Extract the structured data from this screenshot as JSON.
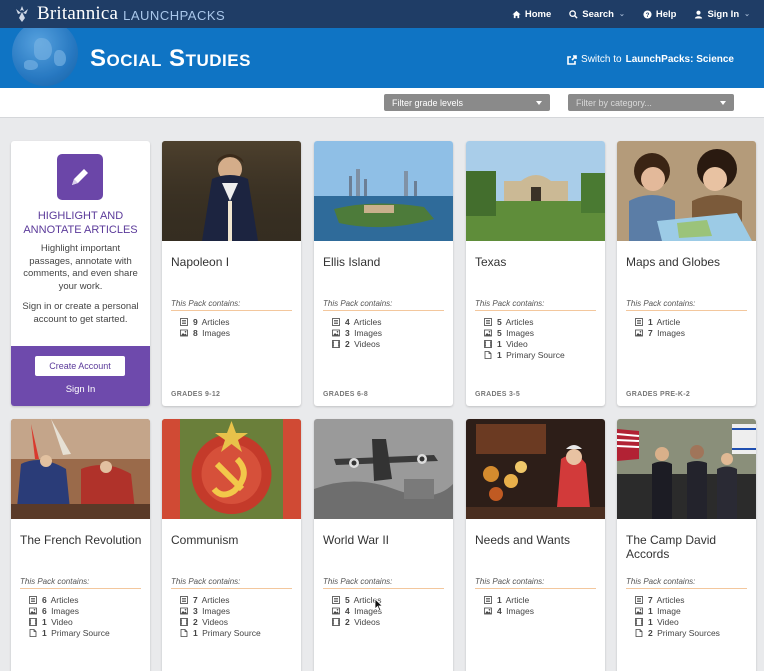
{
  "topbar": {
    "brand_name": "Britannica",
    "brand_sub": "LAUNCHPACKS",
    "nav": [
      {
        "label": "Home",
        "icon": "home-icon",
        "caret": ""
      },
      {
        "label": "Search",
        "icon": "search-icon",
        "caret": "⌄"
      },
      {
        "label": "Help",
        "icon": "help-icon",
        "caret": ""
      },
      {
        "label": "Sign In",
        "icon": "user-icon",
        "caret": "⌄"
      }
    ]
  },
  "header": {
    "title": "Social Studies",
    "switch_prefix": "Switch to ",
    "switch_target": "LaunchPacks: Science"
  },
  "filters": {
    "grade_label": "Filter grade levels",
    "category_placeholder": "Filter by category..."
  },
  "promo": {
    "heading": "Highlight and Annotate Articles",
    "description": "Highlight important passages, annotate with comments, and even share your work.",
    "description2": "Sign in or create a personal account to get started.",
    "create_button": "Create Account",
    "signin_link": "Sign In"
  },
  "contains_label": "This Pack contains:",
  "colors": {
    "topbar": "#1f3d66",
    "header": "#0f74c4",
    "promo_purple": "#6e4aac",
    "rule_orange": "#f3c79d"
  },
  "cards": [
    {
      "title": "Napoleon I",
      "grade": "GRADES 9-12",
      "thumb": "napoleon-portrait",
      "stats": [
        {
          "count": "9",
          "label": "Articles",
          "icon": "article-icon"
        },
        {
          "count": "8",
          "label": "Images",
          "icon": "image-icon"
        }
      ]
    },
    {
      "title": "Ellis Island",
      "grade": "GRADES 6-8",
      "thumb": "ellis-island-aerial",
      "stats": [
        {
          "count": "4",
          "label": "Articles",
          "icon": "article-icon"
        },
        {
          "count": "3",
          "label": "Images",
          "icon": "image-icon"
        },
        {
          "count": "2",
          "label": "Videos",
          "icon": "video-icon"
        }
      ]
    },
    {
      "title": "Texas",
      "grade": "GRADES 3-5",
      "thumb": "alamo-photo",
      "stats": [
        {
          "count": "5",
          "label": "Articles",
          "icon": "article-icon"
        },
        {
          "count": "5",
          "label": "Images",
          "icon": "image-icon"
        },
        {
          "count": "1",
          "label": "Video",
          "icon": "video-icon"
        },
        {
          "count": "1",
          "label": "Primary Source",
          "icon": "document-icon"
        }
      ]
    },
    {
      "title": "Maps and Globes",
      "grade": "GRADES PRE-K-2",
      "thumb": "kids-with-map",
      "stats": [
        {
          "count": "1",
          "label": "Article",
          "icon": "article-icon"
        },
        {
          "count": "7",
          "label": "Images",
          "icon": "image-icon"
        }
      ]
    },
    {
      "title": "The French Revolution",
      "grade": "",
      "thumb": "revolution-painting",
      "stats": [
        {
          "count": "6",
          "label": "Articles",
          "icon": "article-icon"
        },
        {
          "count": "6",
          "label": "Images",
          "icon": "image-icon"
        },
        {
          "count": "1",
          "label": "Video",
          "icon": "video-icon"
        },
        {
          "count": "1",
          "label": "Primary Source",
          "icon": "document-icon"
        }
      ]
    },
    {
      "title": "Communism",
      "grade": "",
      "thumb": "soviet-emblem",
      "stats": [
        {
          "count": "7",
          "label": "Articles",
          "icon": "article-icon"
        },
        {
          "count": "3",
          "label": "Images",
          "icon": "image-icon"
        },
        {
          "count": "2",
          "label": "Videos",
          "icon": "video-icon"
        },
        {
          "count": "1",
          "label": "Primary Source",
          "icon": "document-icon"
        }
      ]
    },
    {
      "title": "World War II",
      "grade": "",
      "thumb": "fighter-plane",
      "stats": [
        {
          "count": "5",
          "label": "Articles",
          "icon": "article-icon"
        },
        {
          "count": "4",
          "label": "Images",
          "icon": "image-icon"
        },
        {
          "count": "2",
          "label": "Videos",
          "icon": "video-icon"
        }
      ]
    },
    {
      "title": "Needs and Wants",
      "grade": "",
      "thumb": "market-stall",
      "stats": [
        {
          "count": "1",
          "label": "Article",
          "icon": "article-icon"
        },
        {
          "count": "4",
          "label": "Images",
          "icon": "image-icon"
        }
      ]
    },
    {
      "title": "The Camp David Accords",
      "grade": "",
      "thumb": "leaders-handshake",
      "stats": [
        {
          "count": "7",
          "label": "Articles",
          "icon": "article-icon"
        },
        {
          "count": "1",
          "label": "Image",
          "icon": "image-icon"
        },
        {
          "count": "1",
          "label": "Video",
          "icon": "video-icon"
        },
        {
          "count": "2",
          "label": "Primary Sources",
          "icon": "document-icon"
        }
      ]
    }
  ]
}
